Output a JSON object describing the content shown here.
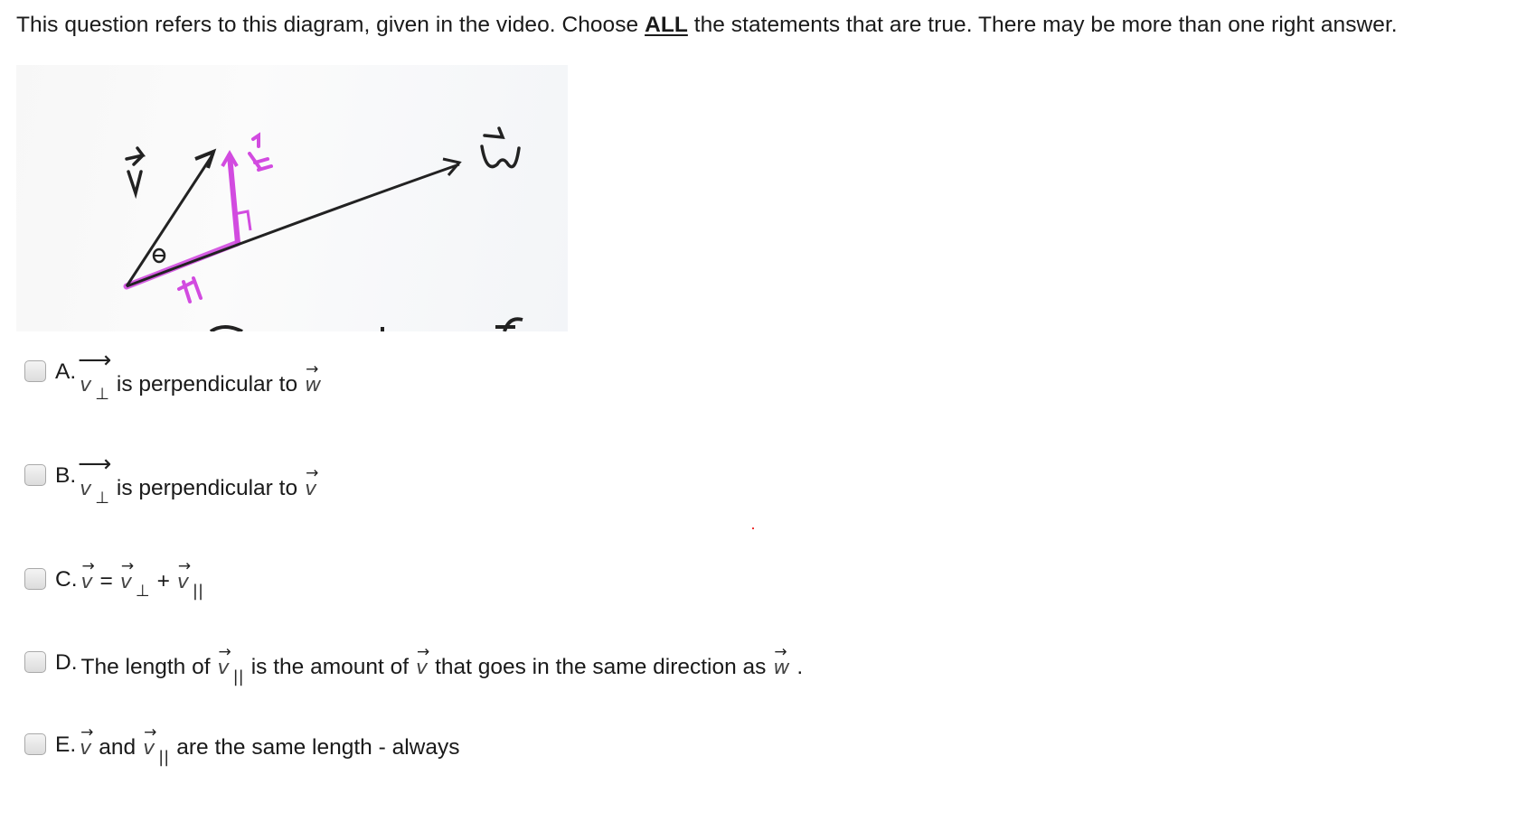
{
  "prompt": {
    "before": "This question refers to this diagram, given in the video.  Choose ",
    "emphasis": "ALL",
    "after": " the statements that are true.  There may be more than one right answer."
  },
  "diagram": {
    "alt": "Hand-drawn vector projection diagram",
    "labels": {
      "v": "v",
      "w": "w",
      "v_perp": "v⊥",
      "v_par": "v∥",
      "angle": "θ"
    },
    "colors": {
      "ink": "#222222",
      "highlight": "#d24be0"
    }
  },
  "options": [
    {
      "letter": "A.",
      "checked": false,
      "vec": "v",
      "sub": "⊥",
      "text": "is perpendicular to",
      "target": "w"
    },
    {
      "letter": "B.",
      "checked": false,
      "vec": "v",
      "sub": "⊥",
      "text": "is perpendicular to",
      "target": "v"
    },
    {
      "letter": "C.",
      "checked": false,
      "lhs": "v",
      "eq": "=",
      "t1": "v",
      "s1": "⊥",
      "plus": "+",
      "t2": "v",
      "s2": "||"
    },
    {
      "letter": "D.",
      "checked": false,
      "p1": "The length of",
      "vec1": "v",
      "sub1": "||",
      "p2": "is the amount of",
      "vec2": "v",
      "p3": "that goes in the same direction as",
      "vec3": "w",
      "end": "."
    },
    {
      "letter": "E.",
      "checked": false,
      "vec1": "v",
      "p1": "and",
      "vec2": "v",
      "sub2": "||",
      "p2": "are the same length - always"
    }
  ]
}
